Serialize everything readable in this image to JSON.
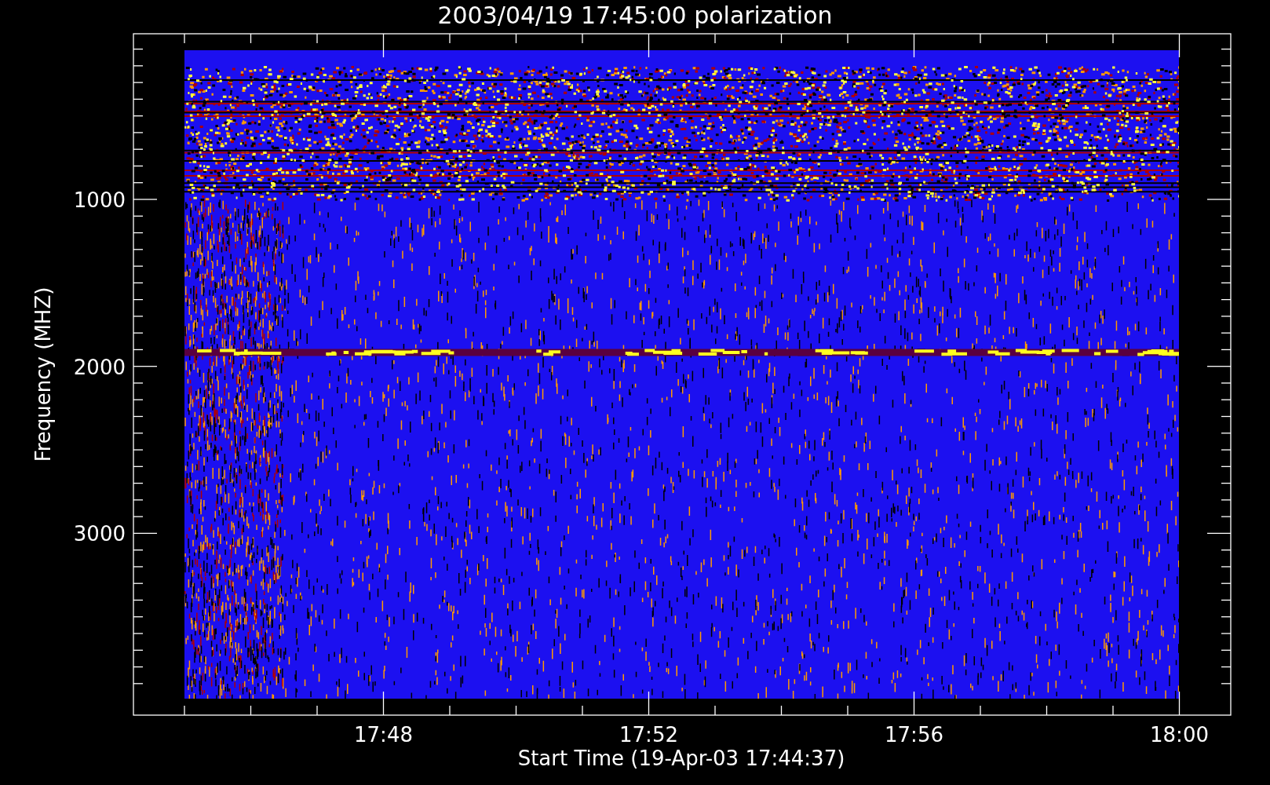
{
  "plot": {
    "title": "2003/04/19 17:45:00 polarization",
    "ylabel": "Frequency (MHZ)",
    "xlabel": "Start Time (19-Apr-03 17:44:37)",
    "yticks": [
      "1000",
      "2000",
      "3000"
    ],
    "xticks": [
      "17:48",
      "17:52",
      "17:56",
      "18:00"
    ]
  }
}
